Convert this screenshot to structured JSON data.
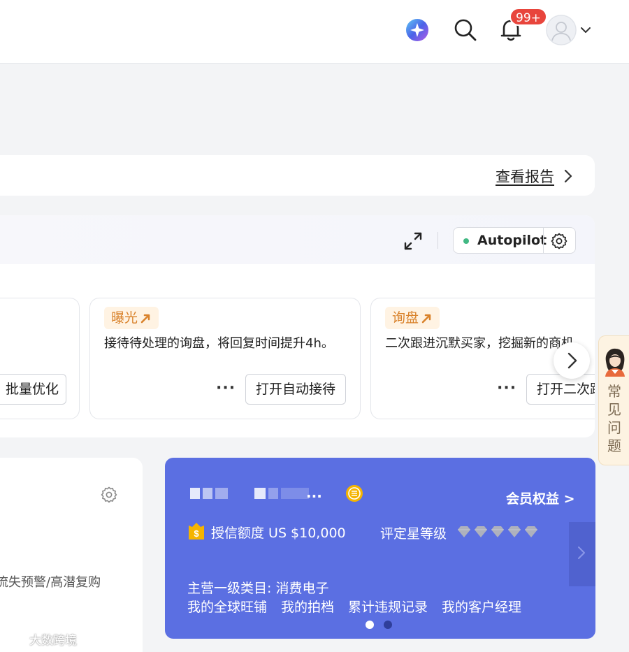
{
  "header": {
    "notifications_badge": "99+"
  },
  "report": {
    "link_label": "查看报告"
  },
  "autopilot": {
    "label": "Autopilot",
    "status_color": "#41b883",
    "cards": [
      {
        "button_label": "批量优化"
      },
      {
        "tag": "曝光",
        "description": "接待待处理的询盘，将回复时间提升4h。",
        "more": "···",
        "button_label": "打开自动接待"
      },
      {
        "tag": "询盘",
        "description": "二次跟进沉默买家，挖掘新的商机。",
        "more": "···",
        "button_label": "打开二次跟进"
      }
    ]
  },
  "faq": {
    "label": "常见问题"
  },
  "left_card": {
    "text": "流失预警/高潜复购"
  },
  "membership": {
    "name_ellipsis": "...",
    "benefits_label": "会员权益 >",
    "credit_label": "授信额度 US $10,000",
    "star_label": "评定星等级",
    "star_count": 5,
    "category_label": "主营一级类目: 消费电子",
    "links": [
      "我的全球旺铺",
      "我的拍档",
      "累计违规记录",
      "我的客户经理"
    ],
    "page_index": 1,
    "page_count": 2,
    "card_color": "#5b6fe2"
  },
  "watermark": {
    "text": "大数跨境"
  }
}
